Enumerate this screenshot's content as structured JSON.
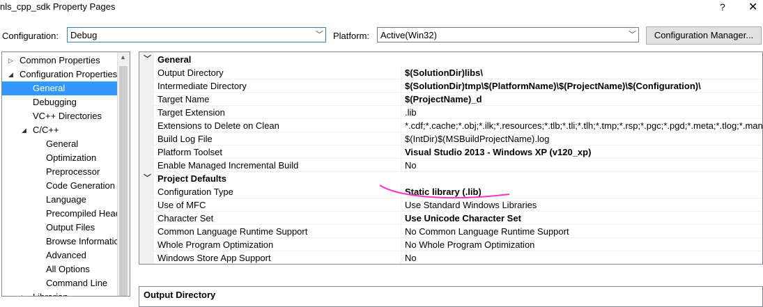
{
  "window": {
    "title": "nls_cpp_sdk Property Pages",
    "help_label": "?",
    "close_label": "✕"
  },
  "config": {
    "configuration_label": "Configuration:",
    "configuration_value": "Debug",
    "platform_label": "Platform:",
    "platform_value": "Active(Win32)",
    "manager_button": "Configuration Manager..."
  },
  "tree": {
    "items": [
      {
        "label": "Common Properties",
        "level": 0,
        "toggle": "▷"
      },
      {
        "label": "Configuration Properties",
        "level": 0,
        "toggle": "◢"
      },
      {
        "label": "General",
        "level": 1,
        "selected": true
      },
      {
        "label": "Debugging",
        "level": 1
      },
      {
        "label": "VC++ Directories",
        "level": 1
      },
      {
        "label": "C/C++",
        "level": 1,
        "toggle": "◢"
      },
      {
        "label": "General",
        "level": 2
      },
      {
        "label": "Optimization",
        "level": 2
      },
      {
        "label": "Preprocessor",
        "level": 2
      },
      {
        "label": "Code Generation",
        "level": 2
      },
      {
        "label": "Language",
        "level": 2
      },
      {
        "label": "Precompiled Heac",
        "level": 2
      },
      {
        "label": "Output Files",
        "level": 2
      },
      {
        "label": "Browse Informatic",
        "level": 2
      },
      {
        "label": "Advanced",
        "level": 2
      },
      {
        "label": "All Options",
        "level": 2
      },
      {
        "label": "Command Line",
        "level": 2
      },
      {
        "label": "Librarian",
        "level": 1,
        "toggle": "▷"
      }
    ]
  },
  "grid": {
    "sections": [
      {
        "title": "General",
        "rows": [
          {
            "name": "Output Directory",
            "value": "$(SolutionDir)libs\\",
            "bold": true
          },
          {
            "name": "Intermediate Directory",
            "value": "$(SolutionDir)tmp\\$(PlatformName)\\$(ProjectName)\\$(Configuration)\\",
            "bold": true
          },
          {
            "name": "Target Name",
            "value": "$(ProjectName)_d",
            "bold": true
          },
          {
            "name": "Target Extension",
            "value": ".lib",
            "bold": false
          },
          {
            "name": "Extensions to Delete on Clean",
            "value": "*.cdf;*.cache;*.obj;*.ilk;*.resources;*.tlb;*.tli;*.tlh;*.tmp;*.rsp;*.pgc;*.pgd;*.meta;*.tlog;*.manif",
            "bold": false
          },
          {
            "name": "Build Log File",
            "value": "$(IntDir)$(MSBuildProjectName).log",
            "bold": false
          },
          {
            "name": "Platform Toolset",
            "value": "Visual Studio 2013 - Windows XP (v120_xp)",
            "bold": true
          },
          {
            "name": "Enable Managed Incremental Build",
            "value": "No",
            "bold": false
          }
        ]
      },
      {
        "title": "Project Defaults",
        "rows": [
          {
            "name": "Configuration Type",
            "value": "Static library (.lib)",
            "bold": true
          },
          {
            "name": "Use of MFC",
            "value": "Use Standard Windows Libraries",
            "bold": false
          },
          {
            "name": "Character Set",
            "value": "Use Unicode Character Set",
            "bold": true
          },
          {
            "name": "Common Language Runtime Support",
            "value": "No Common Language Runtime Support",
            "bold": false
          },
          {
            "name": "Whole Program Optimization",
            "value": "No Whole Program Optimization",
            "bold": false
          },
          {
            "name": "Windows Store App Support",
            "value": "No",
            "bold": false
          }
        ]
      }
    ]
  },
  "description": {
    "title": "Output Directory"
  },
  "colors": {
    "selection": "#3399ff",
    "annotation": "#ff33cc"
  }
}
